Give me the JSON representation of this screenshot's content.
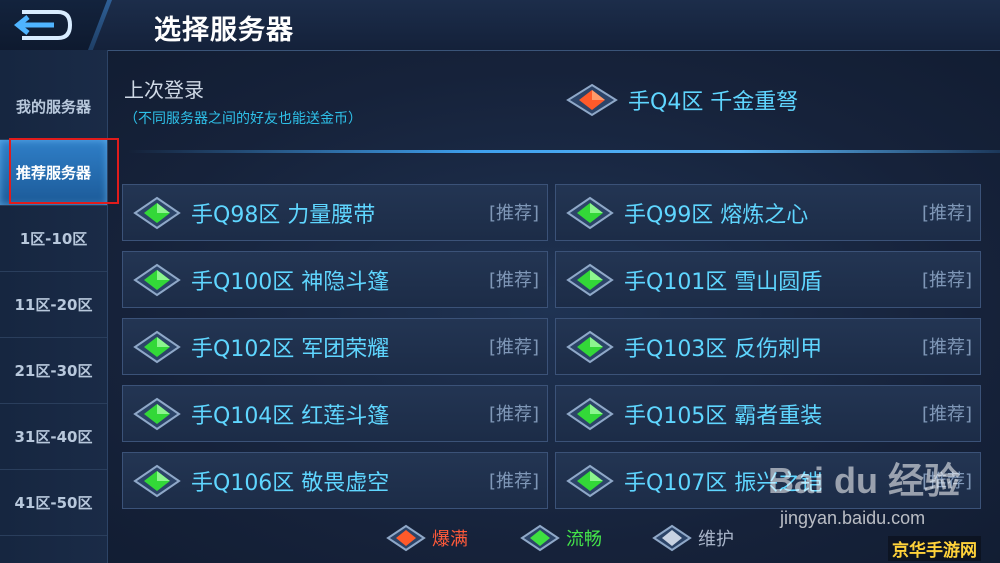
{
  "header": {
    "title": "选择服务器",
    "back_icon": "back-arrow-icon"
  },
  "sidebar": {
    "items": [
      {
        "label": "我的服务器"
      },
      {
        "label": "推荐服务器"
      },
      {
        "label": "1区-10区"
      },
      {
        "label": "11区-20区"
      },
      {
        "label": "21区-30区"
      },
      {
        "label": "31区-40区"
      },
      {
        "label": "41区-50区"
      }
    ],
    "active_index": 1
  },
  "last_login": {
    "label": "上次登录",
    "note": "（不同服务器之间的好友也能送金币）",
    "server": "手Q4区  千金重弩",
    "status": "full"
  },
  "servers": [
    {
      "name": "手Q98区  力量腰带",
      "tag": "[推荐]",
      "status": "smooth"
    },
    {
      "name": "手Q99区  熔炼之心",
      "tag": "[推荐]",
      "status": "smooth"
    },
    {
      "name": "手Q100区  神隐斗篷",
      "tag": "[推荐]",
      "status": "smooth"
    },
    {
      "name": "手Q101区  雪山圆盾",
      "tag": "[推荐]",
      "status": "smooth"
    },
    {
      "name": "手Q102区  军团荣耀",
      "tag": "[推荐]",
      "status": "smooth"
    },
    {
      "name": "手Q103区  反伤刺甲",
      "tag": "[推荐]",
      "status": "smooth"
    },
    {
      "name": "手Q104区  红莲斗篷",
      "tag": "[推荐]",
      "status": "smooth"
    },
    {
      "name": "手Q105区  霸者重装",
      "tag": "[推荐]",
      "status": "smooth"
    },
    {
      "name": "手Q106区  敬畏虚空",
      "tag": "[推荐]",
      "status": "smooth"
    },
    {
      "name": "手Q107区  振兴之铠",
      "tag": "[推荐]",
      "status": "smooth"
    }
  ],
  "legend": [
    {
      "label": "爆满",
      "status": "full",
      "color": "#ff5a3a"
    },
    {
      "label": "流畅",
      "status": "smooth",
      "color": "#44e44a"
    },
    {
      "label": "维护",
      "status": "maintenance",
      "color": "#a8b4c8"
    }
  ],
  "watermarks": {
    "baidu": "Bai du 经验",
    "jingyan": "jingyan.baidu.com",
    "site": "京华手游网"
  }
}
